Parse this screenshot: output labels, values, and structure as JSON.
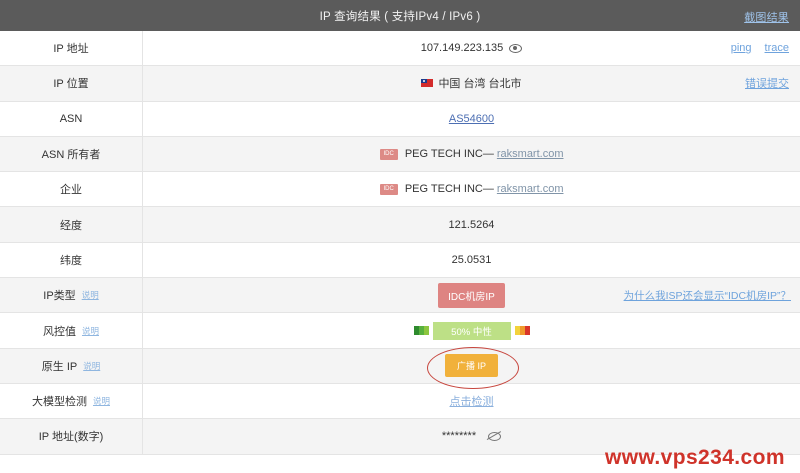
{
  "header": {
    "title": "IP 查询结果 ( 支持IPv4 / IPv6 )",
    "link": "截图结果"
  },
  "rows": {
    "ip": {
      "label": "IP 地址",
      "value": "107.149.223.135",
      "ping": "ping",
      "trace": "trace"
    },
    "location": {
      "label": "IP 位置",
      "value": "中国 台湾 台北市",
      "link": "错误提交"
    },
    "asn": {
      "label": "ASN",
      "value": "AS54600"
    },
    "asn_owner": {
      "label": "ASN 所有者",
      "tag": "IDC",
      "name": "PEG TECH INC—",
      "domain": "raksmart.com"
    },
    "company": {
      "label": "企业",
      "tag": "IDC",
      "name": "PEG TECH INC—",
      "domain": "raksmart.com"
    },
    "longitude": {
      "label": "经度",
      "value": "121.5264"
    },
    "latitude": {
      "label": "纬度",
      "value": "25.0531"
    },
    "ip_type": {
      "label": "IP类型",
      "mini": "说明",
      "value": "IDC机房IP",
      "link": "为什么我ISP还会显示“IDC机房IP”？"
    },
    "risk": {
      "label": "风控值",
      "mini": "说明",
      "value": "50% 中性",
      "level": 0.5
    },
    "native": {
      "label": "原生 IP",
      "mini": "说明",
      "value": "广播 IP"
    },
    "llm": {
      "label": "大模型检测",
      "mini": "说明",
      "value": "点击检测"
    },
    "ip_numeric": {
      "label": "IP 地址(数字)",
      "value": "********"
    }
  },
  "watermark": "www.vps234.com",
  "colors": {
    "header_bg": "#5b5b5b",
    "idc_badge": "#de8482",
    "native_badge": "#f1b13b",
    "risk_fill": "#bde086",
    "watermark": "#cf332a"
  }
}
